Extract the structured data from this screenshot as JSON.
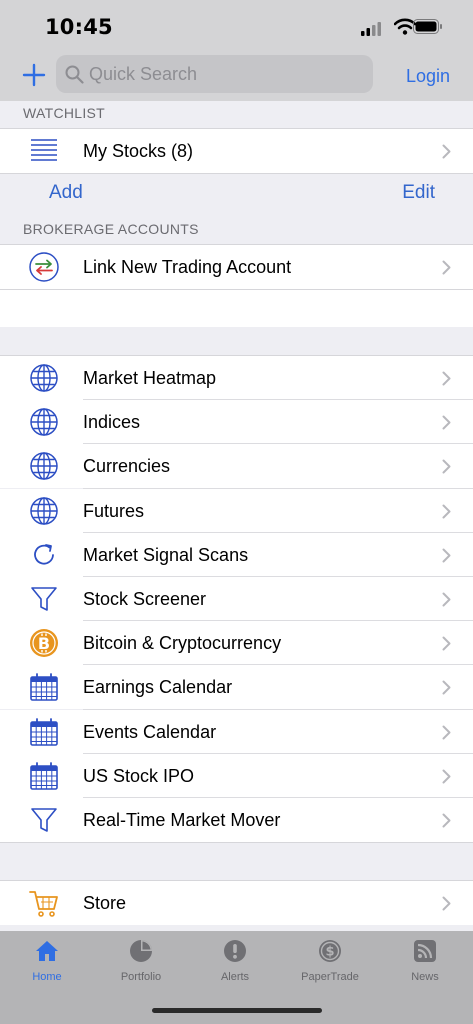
{
  "status": {
    "time": "10:45"
  },
  "nav": {
    "search_placeholder": "Quick Search",
    "login": "Login"
  },
  "watchlist": {
    "header": "WATCHLIST",
    "item": "My Stocks (8)",
    "add": "Add",
    "edit": "Edit"
  },
  "brokerage": {
    "header": "BROKERAGE ACCOUNTS",
    "item": "Link New Trading Account"
  },
  "menu": [
    {
      "label": "Market Heatmap",
      "icon": "globe-icon"
    },
    {
      "label": "Indices",
      "icon": "globe-icon"
    },
    {
      "label": "Currencies",
      "icon": "globe-icon"
    },
    {
      "label": "Futures",
      "icon": "globe-icon"
    },
    {
      "label": "Market Signal Scans",
      "icon": "refresh-icon"
    },
    {
      "label": "Stock Screener",
      "icon": "funnel-icon"
    },
    {
      "label": "Bitcoin & Cryptocurrency",
      "icon": "bitcoin-icon"
    },
    {
      "label": "Earnings Calendar",
      "icon": "calendar-icon"
    },
    {
      "label": "Events Calendar",
      "icon": "calendar-icon"
    },
    {
      "label": "US Stock IPO",
      "icon": "calendar-icon"
    },
    {
      "label": "Real-Time Market Mover",
      "icon": "funnel-icon"
    }
  ],
  "store": {
    "label": "Store",
    "icon": "cart-icon"
  },
  "tabs": [
    {
      "label": "Home",
      "icon": "home-icon",
      "active": true
    },
    {
      "label": "Portfolio",
      "icon": "pie-chart-icon"
    },
    {
      "label": "Alerts",
      "icon": "alert-icon"
    },
    {
      "label": "PaperTrade",
      "icon": "dollar-icon"
    },
    {
      "label": "News",
      "icon": "rss-icon"
    }
  ],
  "colors": {
    "accent": "#2f6ee3",
    "icon_blue": "#2d4fc4",
    "orange": "#e8951f"
  }
}
